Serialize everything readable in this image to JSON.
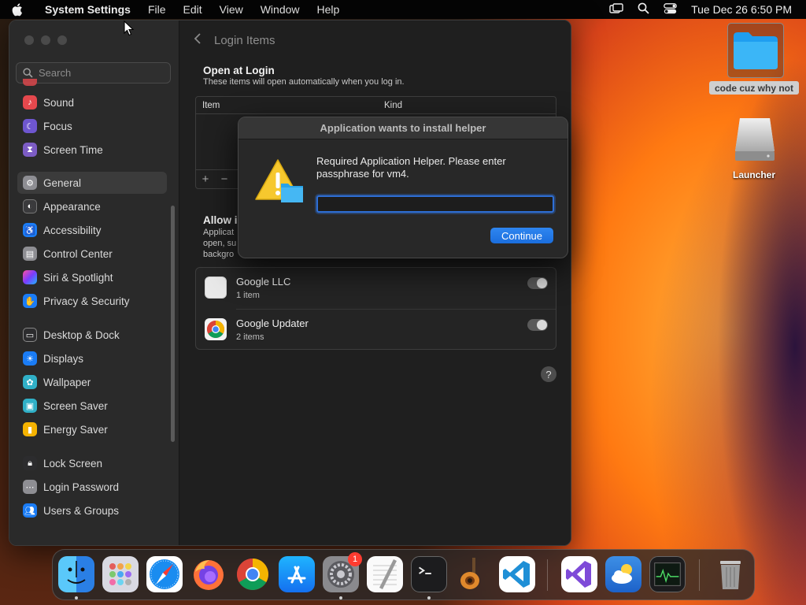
{
  "menubar": {
    "app_name": "System Settings",
    "menus": [
      "File",
      "Edit",
      "View",
      "Window",
      "Help"
    ],
    "datetime": "Tue Dec 26  6:50 PM"
  },
  "sidebar": {
    "search_placeholder": "Search",
    "items": [
      {
        "label": "Sound",
        "icon": "sound-icon",
        "color": "#e5484d"
      },
      {
        "label": "Focus",
        "icon": "focus-icon",
        "color": "#6e56cf"
      },
      {
        "label": "Screen Time",
        "icon": "screen-time-icon",
        "color": "#7c5cc4"
      },
      {
        "label": "General",
        "icon": "general-icon",
        "color": "#8e8e93"
      },
      {
        "label": "Appearance",
        "icon": "appearance-icon",
        "color": "#3a3a3c"
      },
      {
        "label": "Accessibility",
        "icon": "accessibility-icon",
        "color": "#1a7cf5"
      },
      {
        "label": "Control Center",
        "icon": "control-center-icon",
        "color": "#8e8e93"
      },
      {
        "label": "Siri & Spotlight",
        "icon": "siri-icon",
        "color": "#a23ad1"
      },
      {
        "label": "Privacy & Security",
        "icon": "privacy-icon",
        "color": "#1a7cf5"
      },
      {
        "label": "Desktop & Dock",
        "icon": "desktop-dock-icon",
        "color": "#2c2c2e"
      },
      {
        "label": "Displays",
        "icon": "displays-icon",
        "color": "#1a7cf5"
      },
      {
        "label": "Wallpaper",
        "icon": "wallpaper-icon",
        "color": "#30b0c7"
      },
      {
        "label": "Screen Saver",
        "icon": "screen-saver-icon",
        "color": "#30b0c7"
      },
      {
        "label": "Energy Saver",
        "icon": "energy-saver-icon",
        "color": "#f5b301"
      },
      {
        "label": "Lock Screen",
        "icon": "lock-screen-icon",
        "color": "#2c2c2e"
      },
      {
        "label": "Login Password",
        "icon": "login-password-icon",
        "color": "#8e8e93"
      },
      {
        "label": "Users & Groups",
        "icon": "users-groups-icon",
        "color": "#1a7cf5"
      }
    ],
    "selected": "General"
  },
  "main": {
    "title": "Login Items",
    "open_at_login": {
      "title": "Open at Login",
      "subtitle": "These items will open automatically when you log in.",
      "col_item": "Item",
      "col_kind": "Kind",
      "add": "+",
      "remove": "−"
    },
    "allow_background": {
      "title": "Allow in",
      "text": "Applicat open, su backgro"
    },
    "apps": [
      {
        "name": "Google LLC",
        "count": "1 item",
        "enabled": true
      },
      {
        "name": "Google Updater",
        "count": "2 items",
        "enabled": true
      }
    ],
    "help": "?"
  },
  "dialog": {
    "title": "Application wants to install helper",
    "message": "Required Application Helper. Please enter passphrase for vm4.",
    "password_value": "",
    "continue_label": "Continue"
  },
  "desktop": {
    "folder_label": "code cuz why not",
    "drive_label": "Launcher"
  },
  "dock": {
    "apps": [
      "Finder",
      "Launchpad",
      "Safari",
      "Firefox",
      "Google Chrome",
      "App Store",
      "System Settings",
      "TextEdit",
      "Terminal",
      "GarageBand",
      "Visual Studio Code",
      "Visual Studio",
      "Weather",
      "Activity Monitor",
      "Trash"
    ],
    "system_settings_badge": "1"
  }
}
